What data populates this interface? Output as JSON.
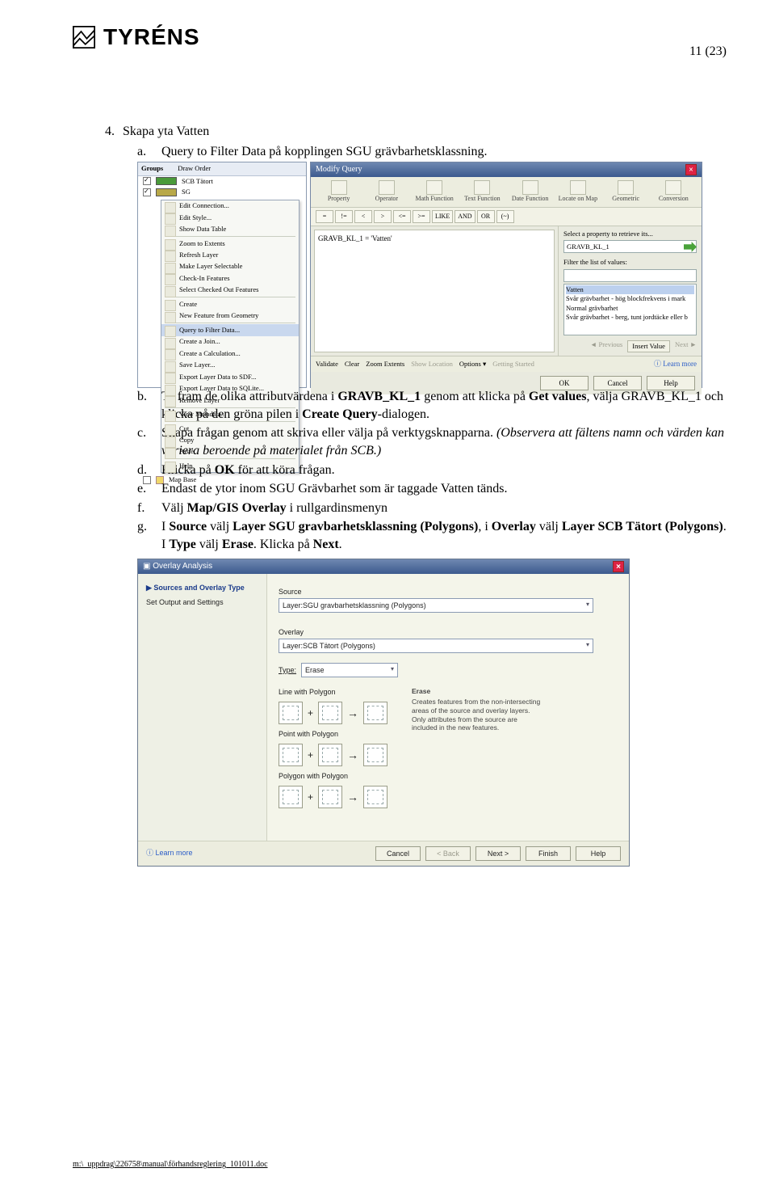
{
  "header": {
    "brand": "TYRÉNS",
    "page_indicator": "11 (23)"
  },
  "section": {
    "num4": "4.",
    "title4": "Skapa yta Vatten",
    "a": {
      "marker": "a.",
      "pre": "Query to Filter Data",
      "post": " på kopplingen SGU grävbarhetsklassning."
    },
    "b": {
      "marker": "b.",
      "t1": "Ta fram de olika attributvärdena i ",
      "kw1": "GRAVB_KL_1",
      "t2": " genom att klicka på ",
      "kw2": "Get values",
      "t3": ", välja GRAVB_KL_1 och klicka på den gröna pilen i ",
      "kw3": "Create Query",
      "t4": "-dialogen."
    },
    "c": {
      "marker": "c.",
      "t1": "Skapa frågan genom att skriva eller välja på verktygsknapparna. ",
      "it": "(Observera att fältens namn och värden kan variera beroende på materialet från SCB.)"
    },
    "d": {
      "marker": "d.",
      "t1": "Klicka på ",
      "kw": "OK",
      "t2": " för att köra frågan."
    },
    "e": {
      "marker": "e.",
      "t1": "Endast de ytor inom SGU Grävbarhet som är taggade Vatten tänds."
    },
    "f": {
      "marker": "f.",
      "t1": "Välj ",
      "kw": "Map/GIS Overlay",
      "t2": " i rullgardinsmenyn"
    },
    "g": {
      "marker": "g.",
      "t1": "I ",
      "kw1": "Source",
      "t2": " välj ",
      "kw2": "Layer SGU gravbarhetsklassning (Polygons)",
      "t3": ", i ",
      "kw3": "Overlay",
      "t4": " välj ",
      "kw4": "Layer SCB Tätort (Polygons)",
      "t5": ". I ",
      "kw5": "Type",
      "t6": " välj ",
      "kw6": "Erase",
      "t7": ". Klicka på ",
      "kw7": "Next",
      "t8": "."
    }
  },
  "ss1": {
    "tabs": {
      "groups": "Groups",
      "draw": "Draw Order"
    },
    "layer1": "SCB Tätort",
    "layer2": "SG",
    "mapbase": "Map Base",
    "ctx": [
      "Edit Connection...",
      "Edit Style...",
      "Show Data Table",
      "—",
      "Zoom to Extents",
      "Refresh Layer",
      "Make Layer Selectable",
      "Check-In Features",
      "Select Checked Out Features",
      "—",
      "Create",
      "New Feature from Geometry",
      "—",
      "Query to Filter Data...",
      "Create a Join...",
      "Create a Calculation...",
      "Save Layer...",
      "Export Layer Data to SDF...",
      "Export Layer Data to SQLite...",
      "Remove Layer",
      "—",
      "View Metadata...",
      "—",
      "Cut",
      "Copy",
      "Paste",
      "—",
      "Help"
    ],
    "mq_title": "Modify Query",
    "toolbar": [
      "Property",
      "Operator",
      "Math Function",
      "Text Function",
      "Date Function",
      "Locate on Map",
      "Geometric",
      "Conversion"
    ],
    "ops": [
      "=",
      "!=",
      "<",
      ">",
      "<=",
      ">=",
      "LIKE",
      "AND",
      "OR",
      "(~)"
    ],
    "query": "GRAVB_KL_1 = 'Vatten'",
    "side_hint": "Select a property to retrieve its...",
    "side_prop": "GRAVB_KL_1",
    "side_filter": "Filter the list of values:",
    "side_values": [
      "Vatten",
      "Svår grävbarhet - hög blockfrekvens i mark",
      "Normal grävbarhet",
      "Svår grävbarhet - berg, tunt jordtäcke eller b"
    ],
    "insert_prev": "◄ Previous",
    "insert_btn": "Insert Value",
    "insert_next": "Next ►",
    "footer_items": [
      "Validate",
      "Clear",
      "Zoom Extents",
      "Show Location",
      "Options ▾",
      "Getting Started"
    ],
    "learn": "Learn more",
    "buttons": [
      "OK",
      "Cancel",
      "Help"
    ]
  },
  "ss2": {
    "title": "Overlay Analysis",
    "steps": [
      "Sources and Overlay Type",
      "Set Output and Settings"
    ],
    "source_label": "Source",
    "source_value": "Layer:SGU gravbarhetsklassning (Polygons)",
    "overlay_label": "Overlay",
    "overlay_value": "Layer:SCB Tätort (Polygons)",
    "type_label": "Type:",
    "type_value": "Erase",
    "diag_labels": [
      "Line with Polygon",
      "Point with Polygon",
      "Polygon with Polygon"
    ],
    "erase_head": "Erase",
    "erase_text": "Creates features from the non-intersecting areas of the source and overlay layers. Only attributes from the source are included in the new features.",
    "learn": "Learn more",
    "buttons": {
      "cancel": "Cancel",
      "back": "< Back",
      "next": "Next >",
      "finish": "Finish",
      "help": "Help"
    }
  },
  "footer_path": "m:\\_uppdrag\\226758\\manual\\förhandsreglering_101011.doc"
}
